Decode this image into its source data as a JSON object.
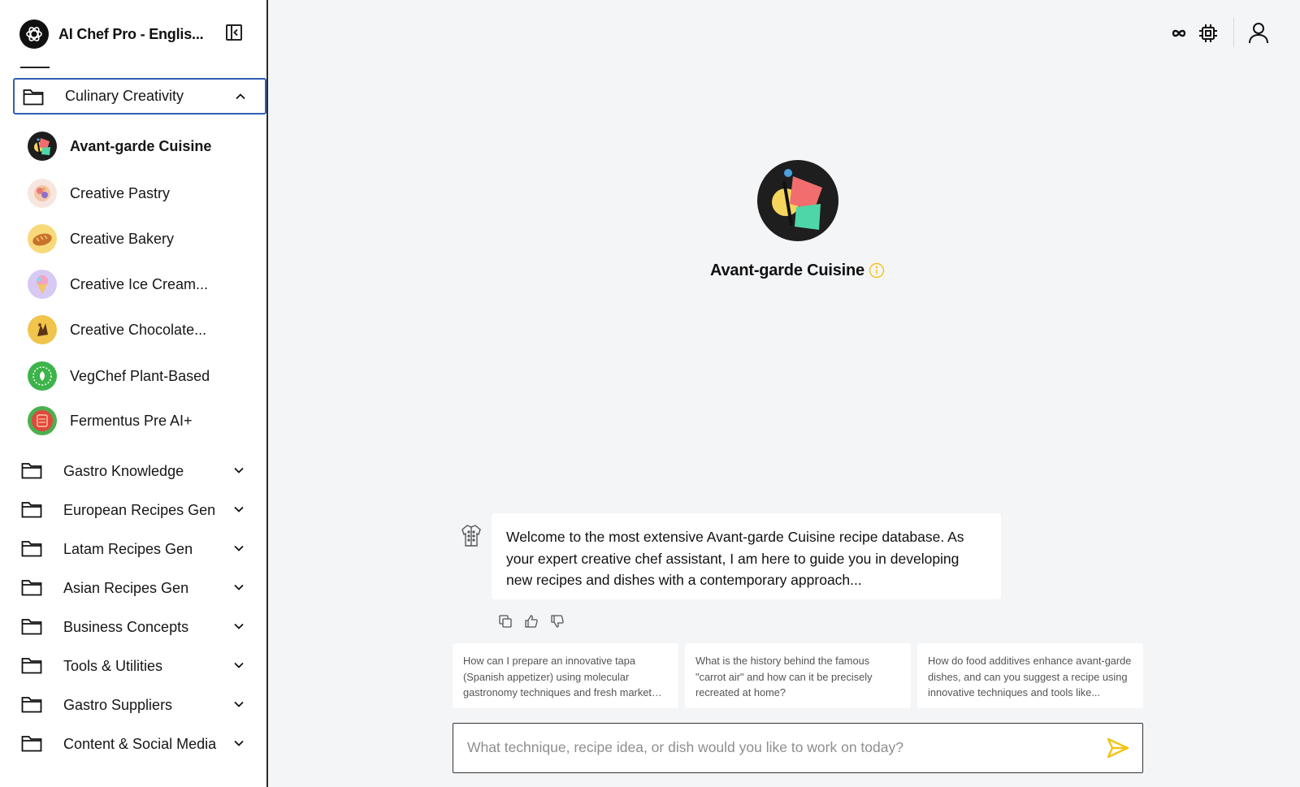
{
  "app": {
    "title": "AI Chef Pro - Englis..."
  },
  "sidebar": {
    "open_folder": {
      "label": "Culinary Creativity",
      "assistants": [
        {
          "label": "Avant-garde Cuisine",
          "active": true,
          "icon": "avant-garde-avatar"
        },
        {
          "label": "Creative Pastry",
          "icon": "pastry-avatar"
        },
        {
          "label": "Creative Bakery",
          "icon": "bread-avatar"
        },
        {
          "label": "Creative Ice Cream...",
          "icon": "ice-cream-avatar"
        },
        {
          "label": "Creative Chocolate...",
          "icon": "chocolate-avatar"
        },
        {
          "label": "VegChef Plant-Based",
          "icon": "plant-based-avatar"
        },
        {
          "label": "Fermentus Pre AI+",
          "icon": "fermentus-avatar"
        }
      ]
    },
    "folders": [
      {
        "label": "Gastro Knowledge"
      },
      {
        "label": "European Recipes Gen"
      },
      {
        "label": "Latam Recipes Gen"
      },
      {
        "label": "Asian Recipes Gen"
      },
      {
        "label": "Business Concepts"
      },
      {
        "label": "Tools & Utilities"
      },
      {
        "label": "Gastro Suppliers"
      },
      {
        "label": "Content & Social Media"
      }
    ]
  },
  "header_icons": [
    "infinity-icon",
    "chip-icon",
    "user-icon"
  ],
  "hero": {
    "name": "Avant-garde Cuisine",
    "info_color": "#f2c318"
  },
  "chat": {
    "welcome_message": "Welcome to the most extensive Avant-garde Cuisine recipe database. As your expert creative chef assistant, I am here to guide you in developing new recipes and dishes with a contemporary approach...",
    "suggestions": [
      "How can I prepare an innovative tapa (Spanish appetizer) using molecular gastronomy techniques and fresh market ingredients?",
      "What is the history behind the famous \"carrot air\" and how can it be precisely recreated at home?",
      "How do food additives enhance avant-garde dishes, and can you suggest a recipe using innovative techniques and tools like..."
    ],
    "input_placeholder": "What technique, recipe idea, or dish would you like to work on today?",
    "send_color": "#f2c318"
  }
}
